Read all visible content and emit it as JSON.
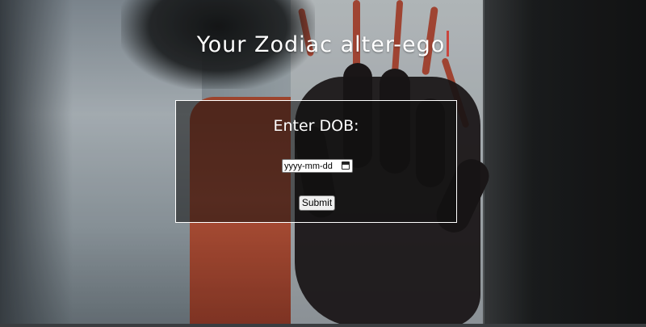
{
  "header": {
    "title": "Your Zodiac alter-ego"
  },
  "form": {
    "label": "Enter DOB:",
    "date_placeholder": "yyyy-mm-dd",
    "date_icon": "calendar-icon",
    "submit_label": "Submit"
  },
  "colors": {
    "caret": "#c9463e",
    "box_border": "#ffffff",
    "text": "#ffffff"
  }
}
